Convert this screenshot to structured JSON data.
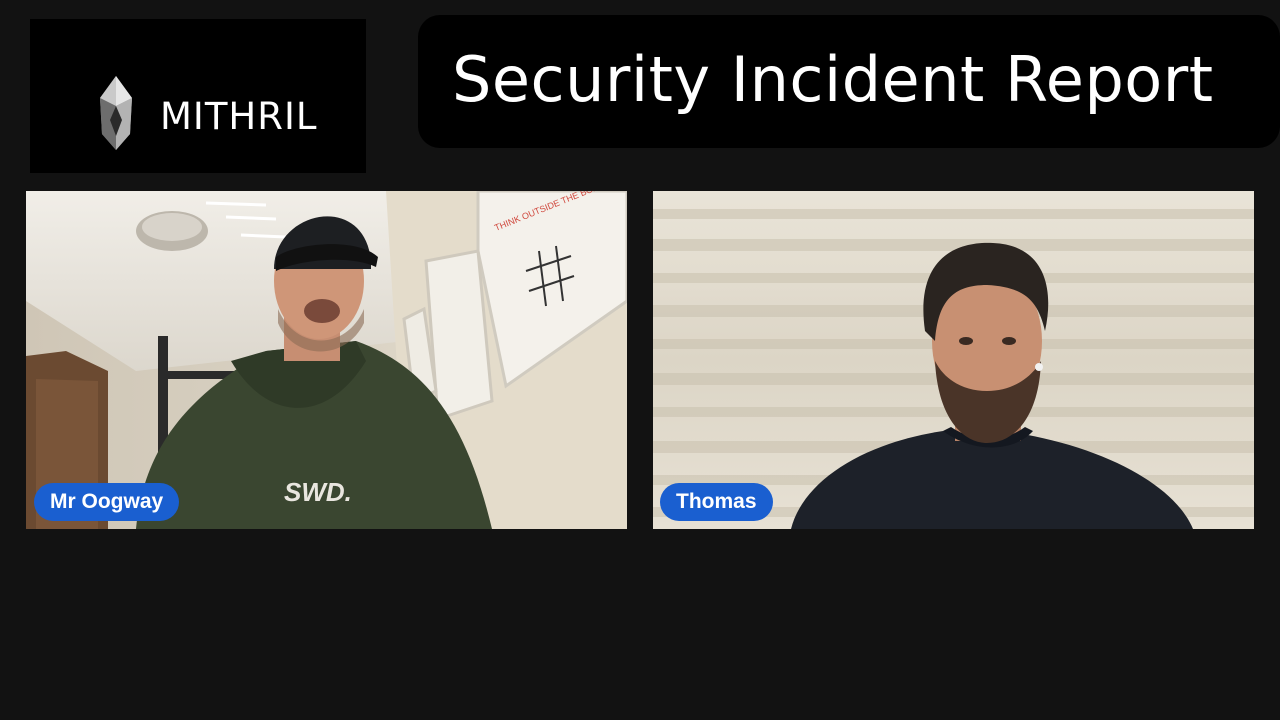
{
  "brand": {
    "name": "MITHRIL"
  },
  "header": {
    "title": "Security Incident Report"
  },
  "participants": [
    {
      "name": "Mr Oogway",
      "icon": "video-feed"
    },
    {
      "name": "Thomas",
      "icon": "video-feed"
    }
  ],
  "poster": {
    "text": "THINK OUTSIDE THE BOX"
  },
  "shirt": {
    "text": "SWD."
  },
  "colors": {
    "background": "#121212",
    "panel": "#000000",
    "name_tag": "#1a5fd0",
    "text": "#ffffff"
  }
}
